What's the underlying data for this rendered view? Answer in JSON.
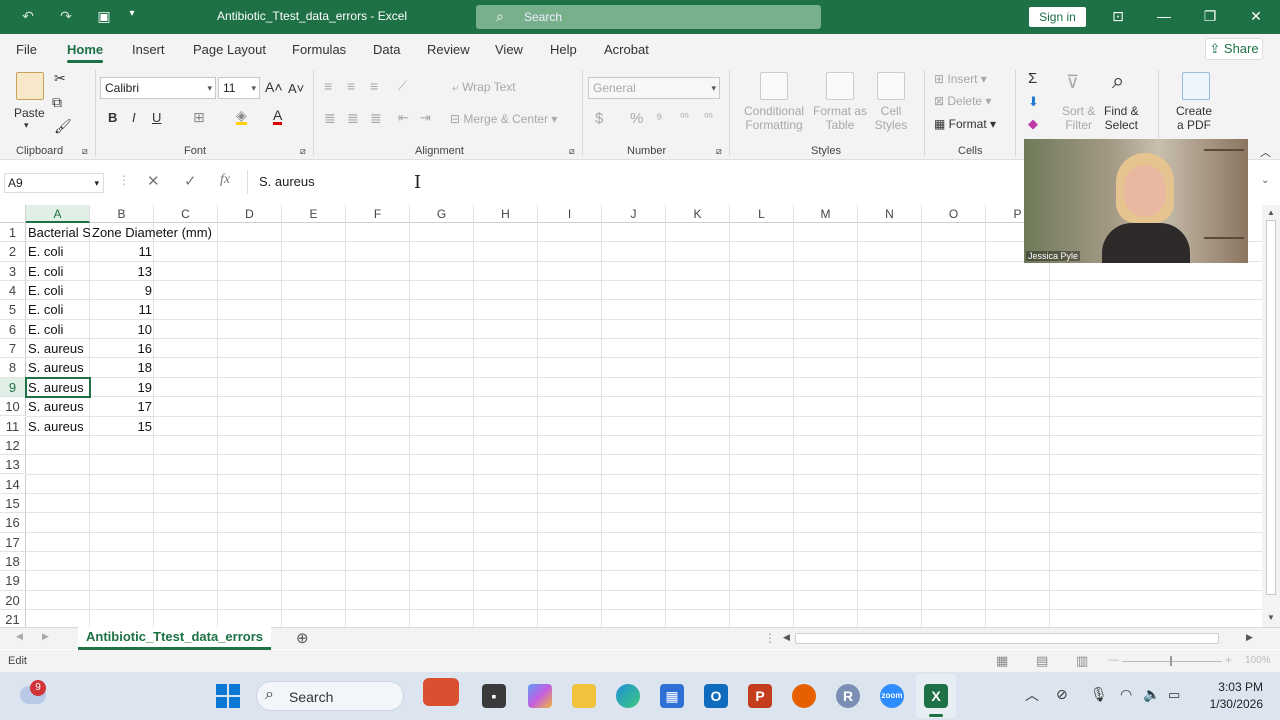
{
  "titlebar": {
    "document_title": "Antibiotic_Ttest_data_errors  -  Excel",
    "search_placeholder": "Search",
    "sign_in": "Sign in"
  },
  "ribbon_tabs": [
    "File",
    "Home",
    "Insert",
    "Page Layout",
    "Formulas",
    "Data",
    "Review",
    "View",
    "Help",
    "Acrobat"
  ],
  "active_tab": "Home",
  "share_label": "Share",
  "ribbon": {
    "clipboard": {
      "paste": "Paste",
      "label": "Clipboard"
    },
    "font": {
      "name": "Calibri",
      "size": "11",
      "label": "Font"
    },
    "alignment": {
      "wrap_text": "Wrap Text",
      "merge_center": "Merge & Center",
      "label": "Alignment"
    },
    "number": {
      "format": "General",
      "label": "Number"
    },
    "styles": {
      "conditional_1": "Conditional",
      "conditional_2": "Formatting",
      "format_as_1": "Format as",
      "format_as_2": "Table",
      "cell_styles_1": "Cell",
      "cell_styles_2": "Styles",
      "label": "Styles"
    },
    "cells": {
      "insert": "Insert",
      "delete": "Delete",
      "format": "Format",
      "label": "Cells"
    },
    "editing": {
      "sort_1": "Sort &",
      "sort_2": "Filter",
      "find_1": "Find &",
      "find_2": "Select"
    },
    "acrobat": {
      "create_1": "Create",
      "create_2": "a PDF"
    }
  },
  "formula_bar": {
    "name_box": "A9",
    "fx": "fx",
    "content": "S. aureus"
  },
  "columns": [
    "A",
    "B",
    "C",
    "D",
    "E",
    "F",
    "G",
    "H",
    "I",
    "J",
    "K",
    "L",
    "M",
    "N",
    "O",
    "P"
  ],
  "rows": [
    "1",
    "2",
    "3",
    "4",
    "5",
    "6",
    "7",
    "8",
    "9",
    "10",
    "11",
    "12",
    "13",
    "14",
    "15",
    "16",
    "17",
    "18",
    "19",
    "20",
    "21"
  ],
  "cells": {
    "A1": "Bacterial S",
    "B1": "Zone Diameter (mm)",
    "A2": "E. coli",
    "B2": "11",
    "A3": "E. coli",
    "B3": "13",
    "A4": "E. coli",
    "B4": "9",
    "A5": "E. coli",
    "B5": "11",
    "A6": "E. coli",
    "B6": "10",
    "A7": "S. aureus",
    "B7": "16",
    "A8": "S. aureus",
    "B8": "18",
    "A9": "S. aureus",
    "B9": "19",
    "A10": "S. aureus",
    "B10": "17",
    "A11": "S. aureus",
    "B11": "15"
  },
  "selected_cell": "A9",
  "sheet_tab": "Antibiotic_Ttest_data_errors",
  "status_mode": "Edit",
  "zoom": "100%",
  "video": {
    "participant_name": "Jessica Pyle"
  },
  "taskbar": {
    "search": "Search",
    "notification_count": "9",
    "time": "3:03 PM",
    "date": "1/30/2026"
  }
}
